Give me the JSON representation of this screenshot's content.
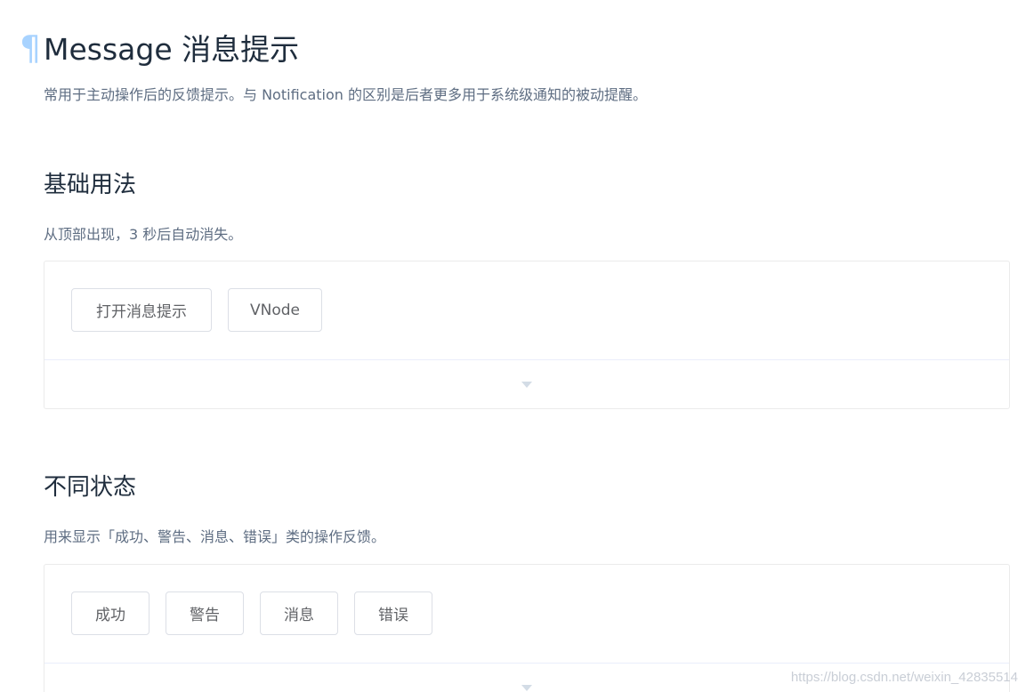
{
  "header": {
    "anchor_symbol": "¶",
    "title": "Message 消息提示",
    "intro": "常用于主动操作后的反馈提示。与 Notification 的区别是后者更多用于系统级通知的被动提醒。"
  },
  "sections": [
    {
      "title": "基础用法",
      "description": "从顶部出现，3 秒后自动消失。",
      "buttons": [
        "打开消息提示",
        "VNode"
      ]
    },
    {
      "title": "不同状态",
      "description": "用来显示「成功、警告、消息、错误」类的操作反馈。",
      "buttons": [
        "成功",
        "警告",
        "消息",
        "错误"
      ]
    }
  ],
  "watermark": "https://blog.csdn.net/weixin_42835514",
  "icons": {
    "expand": "caret-down-icon",
    "anchor": "pilcrow-icon"
  },
  "colors": {
    "title": "#1f2d3d",
    "text": "#5e6d82",
    "button_border": "#dcdfe6",
    "block_border": "#ebebeb",
    "caret": "#d3dce6",
    "anchor": "#409eff"
  }
}
